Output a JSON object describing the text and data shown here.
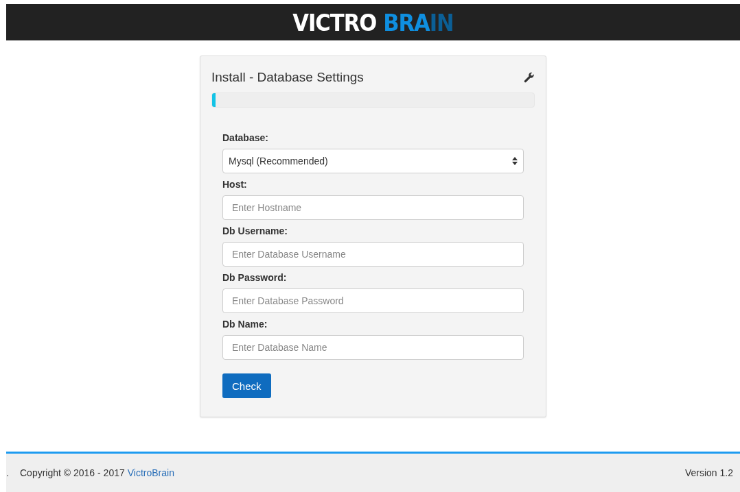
{
  "header": {
    "logo": [
      {
        "text": "VICTRO",
        "color": "#ffffff"
      },
      {
        "text": "BRA",
        "color": "#0f8fe0"
      },
      {
        "text": "IN",
        "color": "#0b5f96"
      }
    ]
  },
  "card": {
    "title": "Install - Database Settings",
    "progress": {
      "level": 0.01
    },
    "fields": [
      {
        "kind": "select",
        "label": "Database:",
        "value": "Mysql (Recommended)"
      },
      {
        "kind": "text",
        "label": "Host:",
        "placeholder": "Enter Hostname"
      },
      {
        "kind": "text",
        "label": "Db Username:",
        "placeholder": "Enter Database Username"
      },
      {
        "kind": "password",
        "label": "Db Password:",
        "placeholder": "Enter Database Password"
      },
      {
        "kind": "text",
        "label": "Db Name:",
        "placeholder": "Enter Database Name"
      }
    ],
    "button": "Check"
  },
  "footer": {
    "mark": ".",
    "copyright": "Copyright © 2016 - 2017",
    "link": "VictroBrain",
    "version": "Version 1.2"
  }
}
